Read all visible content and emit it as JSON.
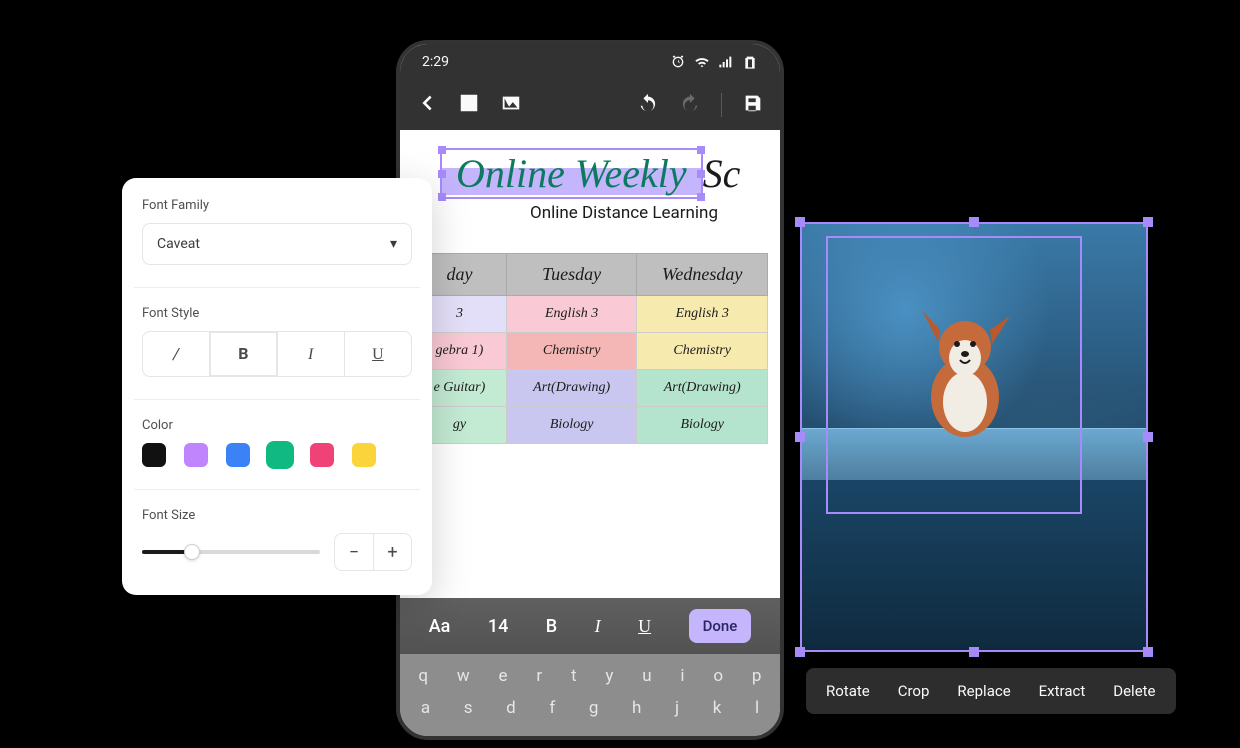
{
  "statusbar": {
    "time": "2:29"
  },
  "document": {
    "title_selected": "Online Weekly",
    "title_rest": " Sc",
    "subtitle": "Online Distance Learning"
  },
  "schedule": {
    "headers": [
      "day",
      "Tuesday",
      "Wednesday"
    ],
    "rows": [
      [
        "3",
        "English 3",
        "English 3"
      ],
      [
        "gebra 1)",
        "Chemistry",
        "Chemistry"
      ],
      [
        "e Guitar)",
        "Art(Drawing)",
        "Art(Drawing)"
      ],
      [
        "gy",
        "Biology",
        "Biology"
      ]
    ]
  },
  "text_toolbar": {
    "font_glyph": "Aa",
    "size": "14",
    "bold": "B",
    "italic": "I",
    "underline": "U",
    "done": "Done"
  },
  "keyboard": {
    "row1": [
      "q",
      "w",
      "e",
      "r",
      "t",
      "y",
      "u",
      "i",
      "o",
      "p"
    ],
    "row2": [
      "a",
      "s",
      "d",
      "f",
      "g",
      "h",
      "j",
      "k",
      "l"
    ]
  },
  "font_panel": {
    "family_label": "Font Family",
    "family_value": "Caveat",
    "style_label": "Font Style",
    "style_slash": "/",
    "style_bold": "B",
    "style_italic": "I",
    "style_underline": "U",
    "color_label": "Color",
    "colors": [
      "#111111",
      "#c084fc",
      "#3b82f6",
      "#10b981",
      "#ef4277",
      "#fbd33a"
    ],
    "selected_color_index": 3,
    "size_label": "Font Size",
    "minus": "−",
    "plus": "+"
  },
  "context_menu": {
    "rotate": "Rotate",
    "crop": "Crop",
    "replace": "Replace",
    "extract": "Extract",
    "delete": "Delete"
  }
}
